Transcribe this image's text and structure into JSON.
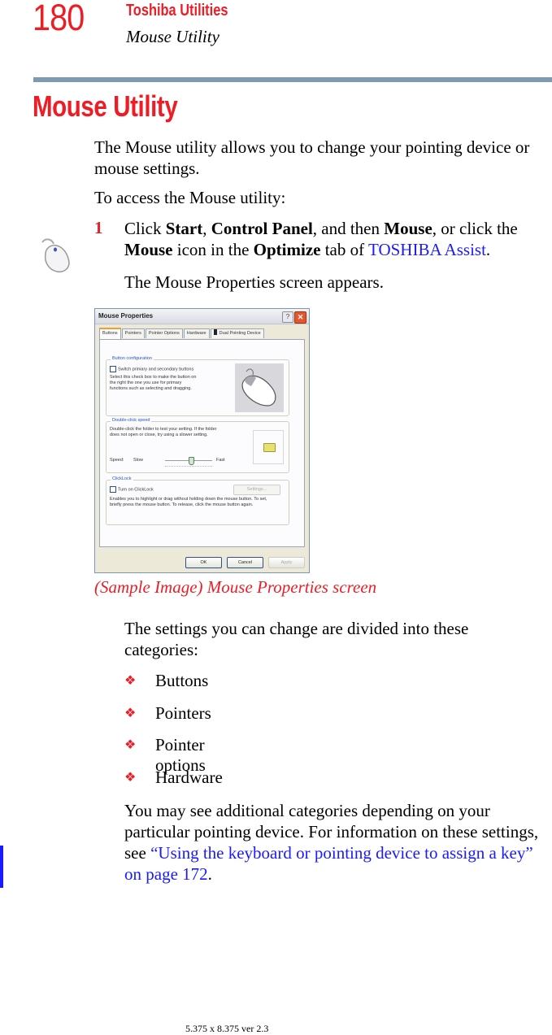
{
  "header": {
    "page_number": "180",
    "chapter": "Toshiba Utilities",
    "section": "Mouse Utility"
  },
  "heading": "Mouse Utility",
  "intro": "The Mouse utility allows you to change your pointing device or mouse settings.",
  "access_intro": "To access the Mouse utility:",
  "step": {
    "number": "1",
    "t1": "Click ",
    "b1": "Start",
    "t2": ", ",
    "b2": "Control Panel",
    "t3": ", and then ",
    "b3": "Mouse",
    "t4": ", or click the ",
    "b4": "Mouse",
    "t5": " icon in the ",
    "b5": "Optimize",
    "t6": " tab of ",
    "link": "TOSHIBA Assist",
    "t7": "."
  },
  "step_result": "The Mouse Properties screen appears.",
  "margin_icon": "mouse-icon",
  "dialog": {
    "title": "Mouse Properties",
    "help": "?",
    "close": "✕",
    "tabs": [
      "Buttons",
      "Pointers",
      "Pointer Options",
      "Hardware",
      "Dual Pointing Device"
    ],
    "active_tab": "Buttons",
    "button_config": {
      "legend": "Button configuration",
      "checkbox_label": "Switch primary and secondary buttons",
      "checked": false,
      "description": "Select this check box to make the button on the right the one you use for primary functions such as selecting and dragging."
    },
    "double_click": {
      "legend": "Double-click speed",
      "description": "Double-click the folder to test your setting. If the folder does not open or close, try using a slower setting.",
      "speed_label": "Speed:",
      "slow_label": "Slow",
      "fast_label": "Fast",
      "speed_value_fraction": 0.55
    },
    "clicklock": {
      "legend": "ClickLock",
      "checkbox_label": "Turn on ClickLock",
      "checked": false,
      "settings_button": "Settings...",
      "description": "Enables you to highlight or drag without holding down the mouse button. To set, briefly press the mouse button. To release, click the mouse button again."
    },
    "buttons": {
      "ok": "OK",
      "cancel": "Cancel",
      "apply": "Apply"
    }
  },
  "caption": "(Sample Image) Mouse Properties screen",
  "categories_intro": "The settings you can change are divided into these categories:",
  "bullet_glyph": "❖",
  "categories": [
    "Buttons",
    "Pointers",
    "Pointer options",
    "Hardware"
  ],
  "closing": {
    "text": "You may see additional categories depending on your particular pointing device. For information on these settings, see ",
    "link": "“Using the keyboard or pointing device to assign a key” on page 172",
    "end": "."
  },
  "footer": "5.375 x 8.375 ver 2.3",
  "colors": {
    "accent_red": "#ee1c25",
    "link_blue": "#1a1aff",
    "rule": "#7f99b0"
  }
}
